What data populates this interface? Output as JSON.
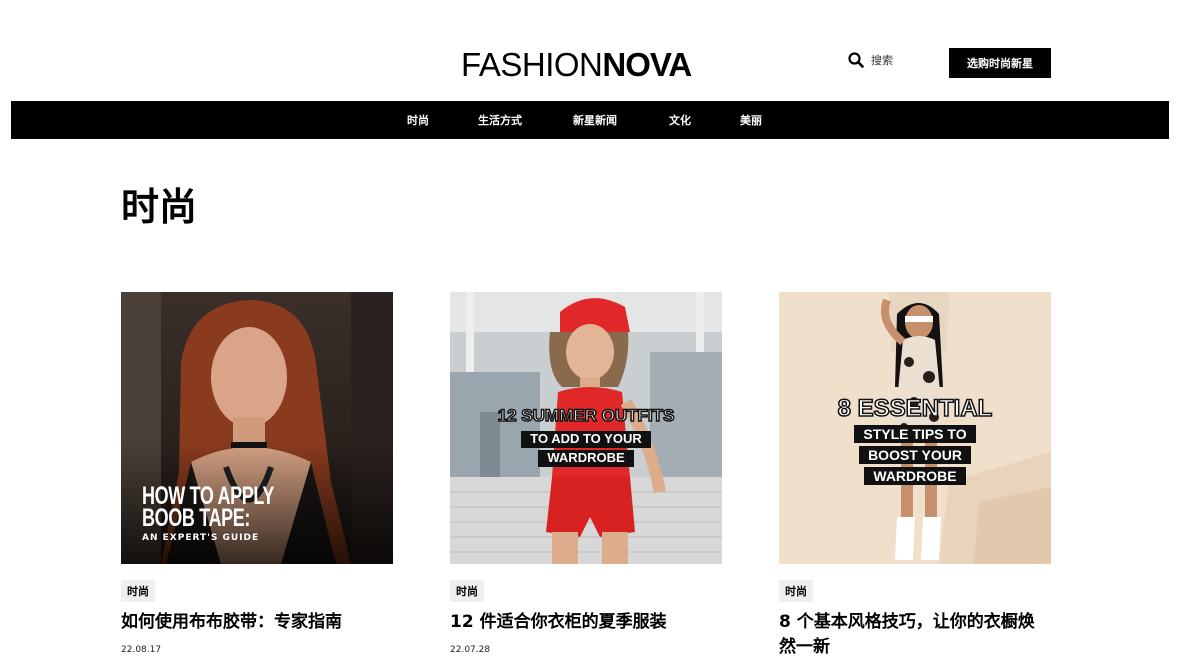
{
  "header": {
    "logo_light": "FASHION",
    "logo_bold": "NOVA",
    "search_label": "搜索",
    "shop_button": "选购时尚新星"
  },
  "nav": {
    "items": [
      "时尚",
      "生活方式",
      "新星新闻",
      "文化",
      "美丽"
    ]
  },
  "page": {
    "title": "时尚"
  },
  "articles": [
    {
      "category": "时尚",
      "title": "如何使用布布胶带：专家指南",
      "date": "22.08.17",
      "overlay": {
        "line1": "HOW TO APPLY",
        "line2": "BOOB TAPE:",
        "line3": "AN EXPERT'S GUIDE"
      }
    },
    {
      "category": "时尚",
      "title": "12 件适合你衣柜的夏季服装",
      "date": "22.07.28",
      "overlay": {
        "line1": "12 SUMMER OUTFITS",
        "line2": "TO ADD TO YOUR",
        "line3": "WARDROBE"
      }
    },
    {
      "category": "时尚",
      "title": "8 个基本风格技巧，让你的衣橱焕然一新",
      "date": "",
      "overlay": {
        "line1": "8 ESSENTIAL",
        "line2": "STYLE TIPS TO",
        "line3": "BOOST YOUR",
        "line4": "WARDROBE"
      }
    }
  ],
  "colors": {
    "nav_bg": "#000000",
    "button_bg": "#000000",
    "tag_bg": "#efefef",
    "card2_accent": "#e02828",
    "card3_bg": "#f0dfca"
  },
  "icons": {
    "search": "search-icon"
  }
}
